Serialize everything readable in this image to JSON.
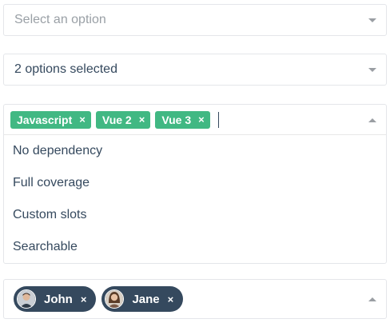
{
  "select_single": {
    "placeholder": "Select an option"
  },
  "select_multi_summary": {
    "value": "2 options selected"
  },
  "select_tags": {
    "tags": [
      {
        "label": "Javascript",
        "remove": "×"
      },
      {
        "label": "Vue 2",
        "remove": "×"
      },
      {
        "label": "Vue 3",
        "remove": "×"
      }
    ],
    "options": [
      "No dependency",
      "Full coverage",
      "Custom slots",
      "Searchable"
    ]
  },
  "select_users": {
    "users": [
      {
        "name": "John",
        "remove": "×",
        "avatar": "avatar-john"
      },
      {
        "name": "Jane",
        "remove": "×",
        "avatar": "avatar-jane"
      }
    ]
  },
  "colors": {
    "tag_green": "#41b883",
    "user_tag_dark": "#35495e",
    "text": "#35495e",
    "placeholder": "#9aa0a6",
    "border": "#e4e6ea"
  },
  "icons": {
    "caret_down": "chevron-down-icon",
    "caret_up": "chevron-up-icon",
    "remove": "close-icon"
  }
}
